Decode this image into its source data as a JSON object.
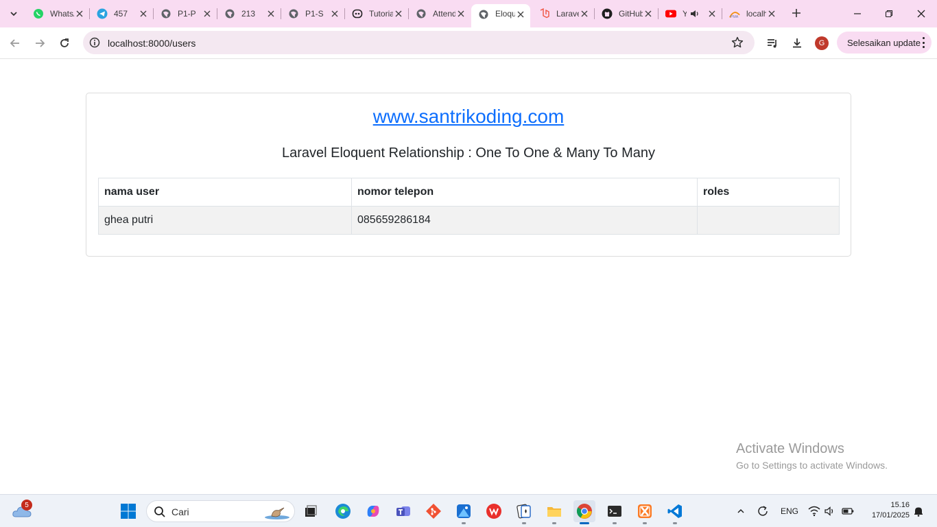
{
  "browser": {
    "tabs": [
      {
        "title": "WhatsApp",
        "icon": "whatsapp-icon"
      },
      {
        "title": "457",
        "icon": "telegram-icon"
      },
      {
        "title": "P1-P",
        "icon": "globe-icon"
      },
      {
        "title": "213",
        "icon": "globe-icon"
      },
      {
        "title": "P1-S",
        "icon": "globe-icon"
      },
      {
        "title": "Tutorial",
        "icon": "copilot-tab-icon"
      },
      {
        "title": "Attendance",
        "icon": "globe-icon"
      },
      {
        "title": "Eloquent",
        "icon": "globe-icon",
        "active": true
      },
      {
        "title": "Laravel",
        "icon": "laravel-icon"
      },
      {
        "title": "GitHub",
        "icon": "github-icon"
      },
      {
        "title": "YouTube",
        "icon": "youtube-icon"
      },
      {
        "title": "localhost",
        "icon": "phpmyadmin-icon"
      }
    ],
    "url": "localhost:8000/users",
    "profile_initial": "G",
    "update_label": "Selesaikan update"
  },
  "page": {
    "site_link": "www.santrikoding.com",
    "heading": "Laravel Eloquent Relationship : One To One & Many To Many",
    "table": {
      "headers": [
        "nama user",
        "nomor telepon",
        "roles"
      ],
      "rows": [
        [
          "ghea putri",
          "085659286184",
          ""
        ]
      ]
    }
  },
  "watermark": {
    "line1": "Activate Windows",
    "line2": "Go to Settings to activate Windows."
  },
  "taskbar": {
    "search_label": "Cari",
    "weather_badge": "5",
    "language": "ENG",
    "time": "15.16",
    "date": "17/01/2025"
  },
  "colors": {
    "tabstrip_bg": "#f9dcf2",
    "link": "#0d6efd",
    "accent": "#0067c0"
  }
}
